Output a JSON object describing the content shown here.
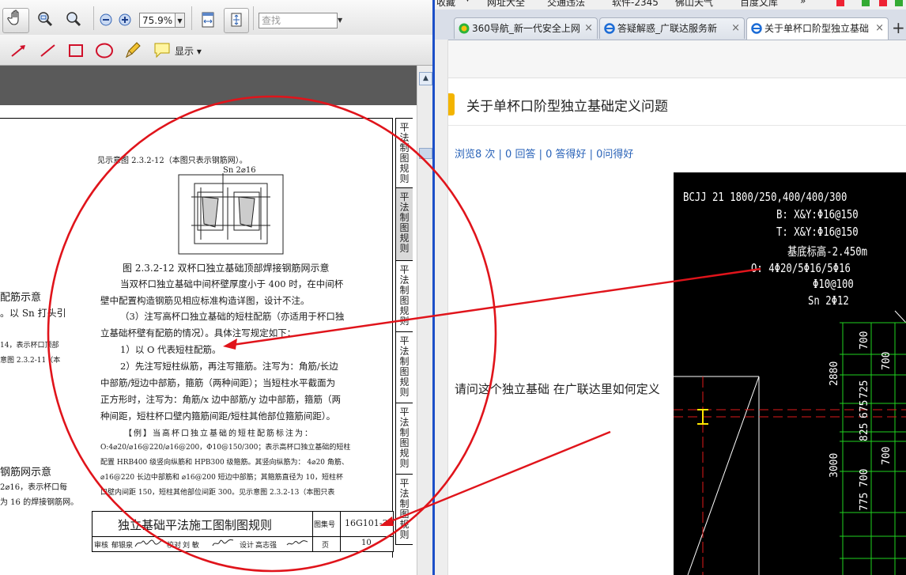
{
  "pdf_viewer": {
    "zoom": "75.9%",
    "find_placeholder": "查找",
    "show_label": "显示",
    "doc": {
      "intro": "见示意图 2.3.2-12（本图只表示钢筋网）。",
      "sn_label": "Sn 2⌀16",
      "figure_caption": "图 2.3.2-12 双杯口独立基础顶部焊接钢筋网示意",
      "para1_l1": "当双杯口独立基础中间杯壁厚度小于 400 时，在中间杯",
      "para1_l2": "壁中配置构造钢筋见相应标准构造详图，设计不注。",
      "para2_l1": "（3）注写高杯口独立基础的短柱配筋（亦适用于杯口独",
      "para2_l2": "立基础杯壁有配筋的情况）。具体注写规定如下：",
      "item1": "1）以 O 代表短柱配筋。",
      "item2_l1": "2）先注写短柱纵筋，再注写箍筋。注写为：角筋/长边",
      "item2_l2": "中部筋/短边中部筋，箍筋（两种间距）；当短柱水平截面为",
      "item2_l3": "正方形时，注写为：角筋/x 边中部筋/y 边中部筋，箍筋（两",
      "item2_l4": "种间距，短柱杯口壁内箍筋间距/短柱其他部位箍筋间距）。",
      "ex_l1": "【例】当高杯口独立基础的短柱配筋标注为：",
      "ex_l2": "O:4⌀20/⌀16@220/⌀16@200，Φ10@150/300；表示高杯口独立基础的短柱",
      "ex_l3": "配置 HRB400 级竖向纵筋和 HPB300 级箍筋。其竖向纵筋为： 4⌀20 角筋、",
      "ex_l4": "⌀16@220 长边中部筋和 ⌀16@200 短边中部筋；其箍筋直径为 10，短柱杯",
      "ex_l5": "口壁内间距 150，短柱其他部位间距 300。见示意图 2.3.2-13（本图只表",
      "left_cut": [
        "配筋示意",
        "。以 Sn 打头引",
        "14，表示杯口顶部",
        "意图 2.3.2-11（本",
        "钢筋网示意",
        "2⌀16，表示杯口每",
        "为 16 的焊接钢筋网。"
      ],
      "footer_title": "独立基础平法施工图制图规则",
      "footer_atlas_label": "图集号",
      "footer_atlas_no": "16G101-3",
      "footer_page_label": "页",
      "footer_page_no": "10",
      "footer_row": [
        "审核",
        "郁银泉",
        "校对",
        "刘 敏",
        "设计",
        "高志强"
      ],
      "side_tabs": [
        "平法制图规则",
        "平法制图规则",
        "平法制图规则",
        "平法制图规则",
        "平法制图规则",
        "平法制图规则"
      ]
    }
  },
  "browser": {
    "bookmarks": [
      "收藏",
      "网址大全",
      "交通违法",
      "软件-2345",
      "佛山天气",
      "百度文库"
    ],
    "tabs": [
      {
        "label": "360导航_新一代安全上网",
        "active": false
      },
      {
        "label": "答疑解惑_广联达服务新",
        "active": false
      },
      {
        "label": "关于单杯口阶型独立基础",
        "active": true
      }
    ],
    "new_tab": "+",
    "close": "×",
    "question": {
      "title": "关于单杯口阶型独立基础定义问题",
      "meta": "浏览8 次 | 0 回答 | 0 答得好 | 0问得好",
      "text": "请问这个独立基础 在广联达里如何定义"
    },
    "cad": {
      "lines": [
        "BCJJ 21 1800/250,400/400/300",
        "B: X&Y:Φ16@150",
        "T: X&Y:Φ16@150",
        "基底标高-2.450m",
        "O: 4Φ20/5Φ16/5Φ16",
        "Φ10@100",
        "Sn  2Φ12"
      ],
      "dims": [
        "700",
        "700",
        "2880",
        "725",
        "675",
        "825",
        "700",
        "3000",
        "700",
        "775"
      ]
    }
  },
  "colors": {
    "annotation_red": "#e0141b",
    "divider_blue": "#1c4fc8",
    "link_blue": "#2a63b8",
    "cad_green": "#1fd21f"
  }
}
